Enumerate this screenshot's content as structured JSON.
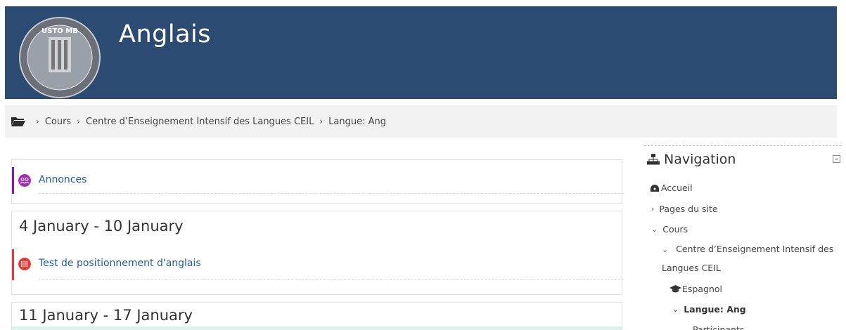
{
  "header": {
    "course_title": "Anglais",
    "logo_text": "USTO MB"
  },
  "breadcrumb": {
    "items": [
      "Cours",
      "Centre d’Enseignement Intensif des Langues CEIL",
      "Langue: Ang"
    ]
  },
  "sections": {
    "annonces": {
      "activity": "Annonces",
      "accent": "#7b1fa2"
    },
    "week1": {
      "title": "4 January - 10 January",
      "activity": "Test de positionnement d'anglais",
      "accent": "#e53935"
    },
    "week2": {
      "title": "11 January - 17 January"
    }
  },
  "navigation": {
    "title": "Navigation",
    "items": {
      "home": "Accueil",
      "site_pages": "Pages du site",
      "courses": "Cours",
      "ceil": "Centre d’Enseignement Intensif des Langues CEIL",
      "espagnol": "Espagnol",
      "langue_ang": "Langue: Ang",
      "participants": "Participants"
    }
  }
}
